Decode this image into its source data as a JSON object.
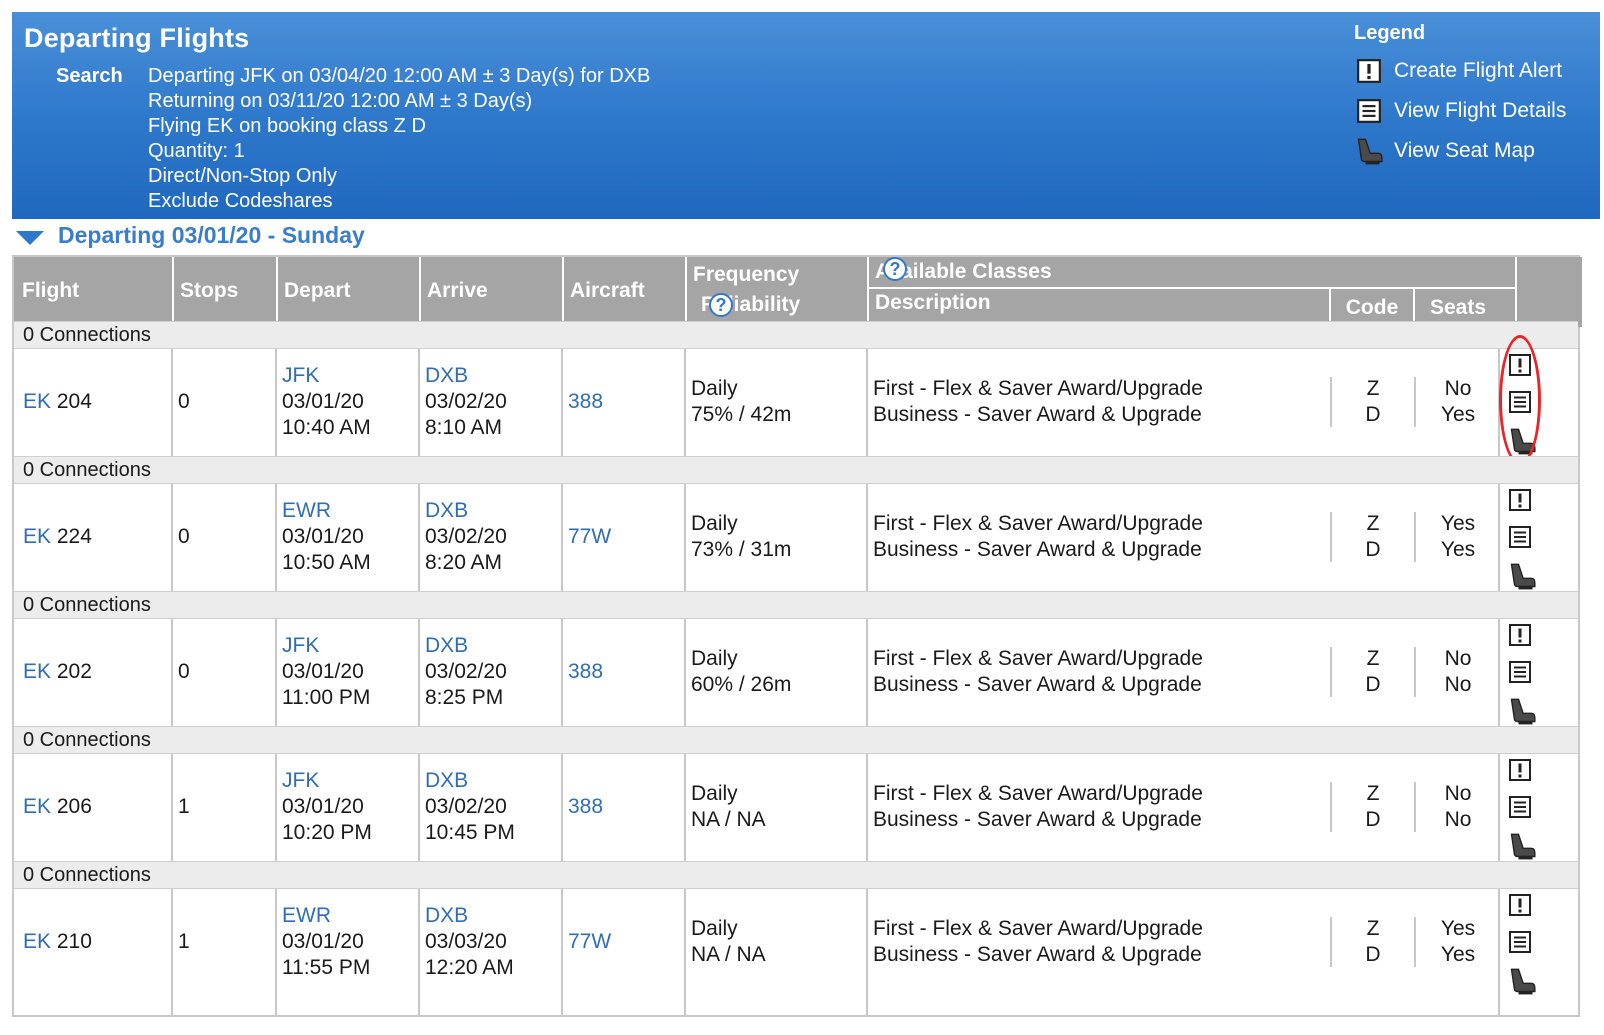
{
  "header": {
    "title": "Departing Flights",
    "search_label": "Search",
    "search_lines": [
      "Departing JFK on 03/04/20 12:00 AM ± 3 Day(s) for DXB",
      "Returning on 03/11/20 12:00 AM ± 3 Day(s)",
      "Flying EK on booking class Z D",
      "Quantity: 1",
      "Direct/Non-Stop Only",
      "Exclude Codeshares"
    ],
    "legend_title": "Legend",
    "legend": [
      {
        "icon": "alert-icon",
        "label": "Create Flight Alert"
      },
      {
        "icon": "details-icon",
        "label": "View Flight Details"
      },
      {
        "icon": "seat-icon",
        "label": "View Seat Map"
      }
    ]
  },
  "section_title": "Departing 03/01/20 - Sunday",
  "columns": {
    "flight": "Flight",
    "stops": "Stops",
    "depart": "Depart",
    "arrive": "Arrive",
    "aircraft": "Aircraft",
    "frequency": "Frequency",
    "reliability": "Reliability",
    "available_classes": "Available Classes",
    "description": "Description",
    "code": "Code",
    "seats": "Seats"
  },
  "flights": [
    {
      "connections": "0 Connections",
      "airline": "EK",
      "number": "204",
      "stops": "0",
      "dep_code": "JFK",
      "dep_date": "03/01/20",
      "dep_time": "10:40 AM",
      "arr_code": "DXB",
      "arr_date": "03/02/20",
      "arr_time": "8:10 AM",
      "aircraft": "388",
      "frequency": "Daily",
      "reliability": "75% / 42m",
      "desc1": "First - Flex & Saver Award/Upgrade",
      "desc2": "Business - Saver Award & Upgrade",
      "code1": "Z",
      "code2": "D",
      "seat1": "No",
      "seat2": "Yes"
    },
    {
      "connections": "0 Connections",
      "airline": "EK",
      "number": "224",
      "stops": "0",
      "dep_code": "EWR",
      "dep_date": "03/01/20",
      "dep_time": "10:50 AM",
      "arr_code": "DXB",
      "arr_date": "03/02/20",
      "arr_time": "8:20 AM",
      "aircraft": "77W",
      "frequency": "Daily",
      "reliability": "73% / 31m",
      "desc1": "First - Flex & Saver Award/Upgrade",
      "desc2": "Business - Saver Award & Upgrade",
      "code1": "Z",
      "code2": "D",
      "seat1": "Yes",
      "seat2": "Yes"
    },
    {
      "connections": "0 Connections",
      "airline": "EK",
      "number": "202",
      "stops": "0",
      "dep_code": "JFK",
      "dep_date": "03/01/20",
      "dep_time": "11:00 PM",
      "arr_code": "DXB",
      "arr_date": "03/02/20",
      "arr_time": "8:25 PM",
      "aircraft": "388",
      "frequency": "Daily",
      "reliability": "60% / 26m",
      "desc1": "First - Flex & Saver Award/Upgrade",
      "desc2": "Business - Saver Award & Upgrade",
      "code1": "Z",
      "code2": "D",
      "seat1": "No",
      "seat2": "No"
    },
    {
      "connections": "0 Connections",
      "airline": "EK",
      "number": "206",
      "stops": "1",
      "dep_code": "JFK",
      "dep_date": "03/01/20",
      "dep_time": "10:20 PM",
      "arr_code": "DXB",
      "arr_date": "03/02/20",
      "arr_time": "10:45 PM",
      "aircraft": "388",
      "frequency": "Daily",
      "reliability": "NA / NA",
      "desc1": "First - Flex & Saver Award/Upgrade",
      "desc2": "Business - Saver Award & Upgrade",
      "code1": "Z",
      "code2": "D",
      "seat1": "No",
      "seat2": "No"
    },
    {
      "connections": "0 Connections",
      "airline": "EK",
      "number": "210",
      "stops": "1",
      "dep_code": "EWR",
      "dep_date": "03/01/20",
      "dep_time": "11:55 PM",
      "arr_code": "DXB",
      "arr_date": "03/03/20",
      "arr_time": "12:20 AM",
      "aircraft": "77W",
      "frequency": "Daily",
      "reliability": "NA / NA",
      "desc1": "First - Flex & Saver Award/Upgrade",
      "desc2": "Business - Saver Award & Upgrade",
      "code1": "Z",
      "code2": "D",
      "seat1": "Yes",
      "seat2": "Yes"
    }
  ],
  "colors": {
    "header_blue": "#2f79cc",
    "link": "#2f6db5",
    "highlight": "#e8262a",
    "table_header": "#a5a5a5"
  }
}
